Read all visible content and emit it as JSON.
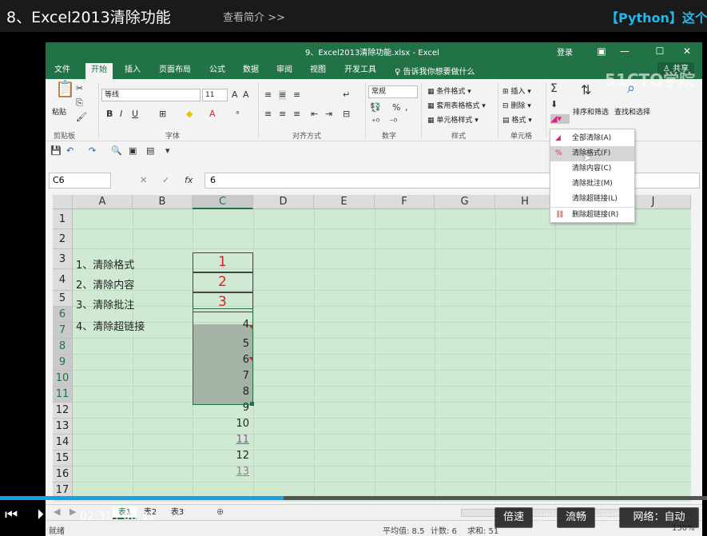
{
  "video": {
    "title": "8、Excel2013清除功能",
    "intro_link": "查看简介 >>",
    "promo": "【Python】这个"
  },
  "excel": {
    "doc_title": "9、Excel2013清除功能.xlsx - Excel",
    "login": "登录",
    "share": "共享",
    "tabs": [
      "文件",
      "开始",
      "插入",
      "页面布局",
      "公式",
      "数据",
      "审阅",
      "视图",
      "开发工具"
    ],
    "tell_me": "告诉我你想要做什么",
    "ribbon": {
      "paste": "粘贴",
      "clipboard": "剪贴板",
      "font_name": "等线",
      "font_size": "11",
      "font_group": "字体",
      "align_group": "对齐方式",
      "number_format": "常规",
      "number_group": "数字",
      "cond_format": "条件格式",
      "table_format": "套用表格格式",
      "cell_style": "单元格样式",
      "style_group": "样式",
      "insert": "插入",
      "delete": "删除",
      "format": "格式",
      "cells_group": "单元格",
      "sort_filter": "排序和筛选",
      "find_select": "查找和选择"
    },
    "name_box": "C6",
    "formula_value": "6",
    "columns": [
      "A",
      "B",
      "C",
      "D",
      "E",
      "F",
      "G",
      "H",
      "I",
      "J"
    ],
    "rows": [
      "1",
      "2",
      "3",
      "4",
      "5",
      "6",
      "7",
      "8",
      "9",
      "10",
      "11",
      "12",
      "13",
      "14",
      "15",
      "16",
      "17"
    ],
    "col_a": [
      "1、清除格式",
      "2、清除内容",
      "3、清除批注",
      "4、清除超链接"
    ],
    "col_c_red": [
      "1",
      "2",
      "3"
    ],
    "col_c_nums": [
      "4",
      "5",
      "6",
      "7",
      "8",
      "9",
      "10",
      "11",
      "12",
      "13"
    ],
    "clear_menu": [
      "全部清除(A)",
      "清除格式(F)",
      "清除内容(C)",
      "清除批注(M)",
      "清除超链接(L)",
      "删除超链接(R)"
    ],
    "sheets": [
      "表1",
      "表2",
      "表3"
    ],
    "status": {
      "ready": "就绪",
      "average": "平均值: 8.5",
      "count": "计数: 6",
      "sum": "求和: 51",
      "zoom": "130%"
    }
  },
  "player": {
    "time": "02:31 / 06:31",
    "speed": "倍速",
    "quality": "流畅",
    "network": "网络：自动",
    "watermark": "https://blog.csdn.net/SeeYouNow1",
    "logo": "51CTO学院"
  },
  "colors": {
    "excel_green": "#217346",
    "grid_green": "#cfe9d3",
    "progress": "#1aa0e6",
    "promo": "#22b8e8",
    "red_text": "#e02020"
  }
}
